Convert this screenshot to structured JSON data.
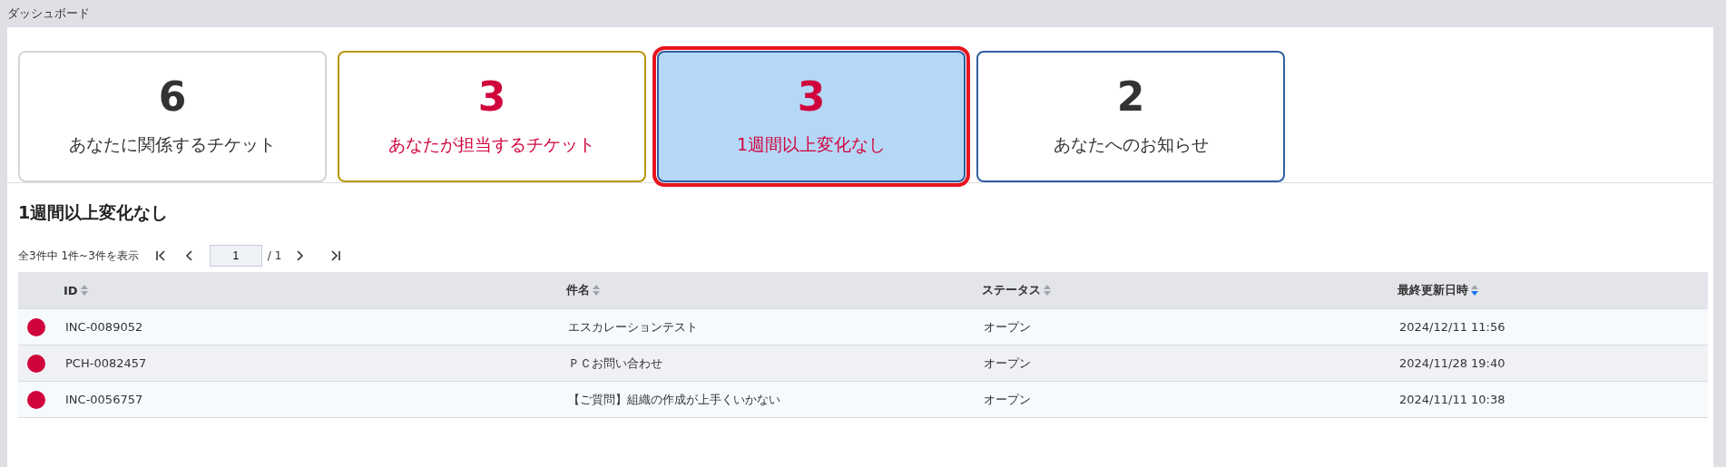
{
  "header": {
    "title": "ダッシュボード"
  },
  "cards": [
    {
      "count": "6",
      "label": "あなたに関係するチケット",
      "color": "#d4d5da",
      "kind": "normal",
      "selected": false
    },
    {
      "count": "3",
      "label": "あなたが担当するチケット",
      "color": "#b8960c",
      "kind": "alert",
      "selected": false
    },
    {
      "count": "3",
      "label": "1週間以上変化なし",
      "color": "#2f5fa0",
      "kind": "alert",
      "selected": true
    },
    {
      "count": "2",
      "label": "あなたへのお知らせ",
      "color": "#2f5fa0",
      "kind": "normal",
      "selected": false
    }
  ],
  "section_title": "1週間以上変化なし",
  "pagination": {
    "summary": "全3件中 1件~3件を表示",
    "page": "1",
    "total": "/ 1"
  },
  "table": {
    "columns": [
      {
        "label": "ID",
        "sorted": false
      },
      {
        "label": "件名",
        "sorted": false
      },
      {
        "label": "ステータス",
        "sorted": false
      },
      {
        "label": "最終更新日時",
        "sorted": true
      }
    ],
    "rows": [
      {
        "color": "#d0043c",
        "cells": [
          "INC-0089052",
          "エスカレーションテスト",
          "オープン",
          "2024/12/11 11:56"
        ]
      },
      {
        "color": "#d0043c",
        "cells": [
          "PCH-0082457",
          "ＰＣお問い合わせ",
          "オープン",
          "2024/11/28 19:40"
        ]
      },
      {
        "color": "#d0043c",
        "cells": [
          "INC-0056757",
          "【ご質問】組織の作成が上手くいかない",
          "オープン",
          "2024/11/11 10:38"
        ]
      }
    ]
  }
}
